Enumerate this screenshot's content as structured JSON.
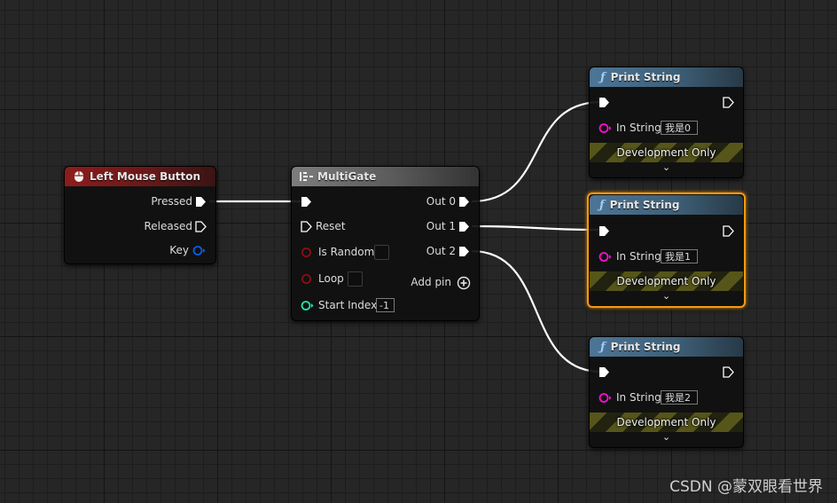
{
  "colors": {
    "exec_wire": "#ffffff",
    "bool_pin": "#8e0f0f",
    "int_pin": "#1fe3af",
    "string_pin": "#f80fd0",
    "struct_pin": "#0a5ce8",
    "selection": "#f39a12"
  },
  "left_mouse_node": {
    "icon": "mouse-icon",
    "title": "Left Mouse Button",
    "pins": {
      "pressed": "Pressed",
      "released": "Released",
      "key": "Key"
    }
  },
  "multigate_node": {
    "icon": "multigate-icon",
    "title": "MultiGate",
    "inputs": {
      "reset": "Reset",
      "is_random": "Is Random",
      "loop": "Loop",
      "start_index": "Start Index",
      "start_index_value": "-1"
    },
    "outputs": {
      "out0": "Out 0",
      "out1": "Out 1",
      "out2": "Out 2",
      "add_pin": "Add pin"
    }
  },
  "print_nodes": [
    {
      "icon": "function-icon",
      "title": "Print String",
      "in_string_label": "In String",
      "in_string_value": "我是0",
      "dev_only": "Development Only",
      "expand_icon": "chevron-down-icon"
    },
    {
      "icon": "function-icon",
      "title": "Print String",
      "in_string_label": "In String",
      "in_string_value": "我是1",
      "dev_only": "Development Only",
      "expand_icon": "chevron-down-icon"
    },
    {
      "icon": "function-icon",
      "title": "Print String",
      "in_string_label": "In String",
      "in_string_value": "我是2",
      "dev_only": "Development Only",
      "expand_icon": "chevron-down-icon"
    }
  ],
  "watermark": "CSDN @蒙双眼看世界"
}
